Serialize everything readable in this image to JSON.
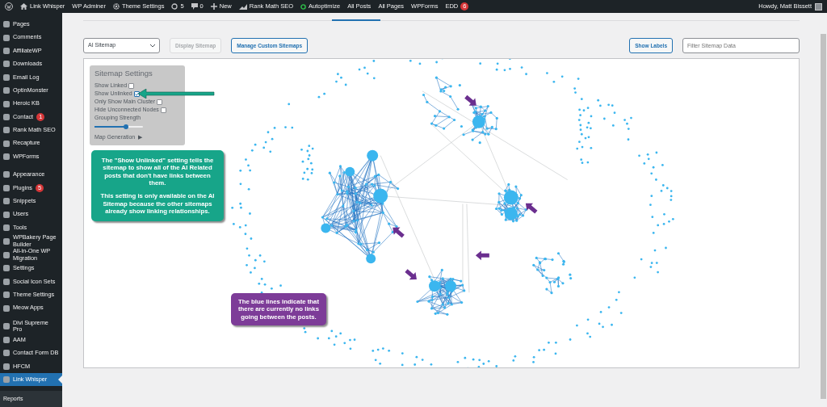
{
  "admin_bar": {
    "items": [
      {
        "kind": "logo"
      },
      {
        "kind": "home",
        "label": "Link Whisper"
      },
      {
        "kind": "text",
        "label": "WP Adminer"
      },
      {
        "kind": "gear",
        "label": "Theme Settings"
      },
      {
        "kind": "updates",
        "label": "5"
      },
      {
        "kind": "comments",
        "label": "0"
      },
      {
        "kind": "plus",
        "label": "New"
      },
      {
        "kind": "chart",
        "label": "Rank Math SEO"
      },
      {
        "kind": "status",
        "label": "Autoptimize"
      },
      {
        "kind": "text",
        "label": "All Posts"
      },
      {
        "kind": "text",
        "label": "All Pages"
      },
      {
        "kind": "text",
        "label": "WPForms"
      },
      {
        "kind": "text",
        "label": "EDD",
        "badge": "6"
      }
    ],
    "account": "Howdy, Matt Bissett"
  },
  "sidebar": {
    "groups": [
      [
        {
          "label": "Pages",
          "selected": false
        },
        {
          "label": "Comments",
          "selected": false
        },
        {
          "label": "AffiliateWP",
          "selected": false
        },
        {
          "label": "Downloads",
          "selected": false
        },
        {
          "label": "Email Log",
          "selected": false
        },
        {
          "label": "OptinMonster",
          "selected": false
        },
        {
          "label": "Heroic KB",
          "selected": false
        },
        {
          "label": "Contact",
          "selected": false,
          "badge": "1"
        },
        {
          "label": "Rank Math SEO",
          "selected": false
        },
        {
          "label": "Recapture",
          "selected": false
        },
        {
          "label": "WPForms",
          "selected": false
        }
      ],
      [
        {
          "label": "Appearance",
          "selected": false
        },
        {
          "label": "Plugins",
          "selected": false,
          "badge": "5"
        },
        {
          "label": "Snippets",
          "selected": false
        },
        {
          "label": "Users",
          "selected": false
        },
        {
          "label": "Tools",
          "selected": false
        },
        {
          "label": "WPBakery Page Builder",
          "selected": false
        },
        {
          "label": "All-in-One WP Migration",
          "selected": false
        },
        {
          "label": "Settings",
          "selected": false
        },
        {
          "label": "Social Icon Sets",
          "selected": false
        },
        {
          "label": "Theme Settings",
          "selected": false
        },
        {
          "label": "Meow Apps",
          "selected": false
        }
      ],
      [
        {
          "label": "Divi Supreme Pro",
          "selected": false
        },
        {
          "label": "AAM",
          "selected": false
        },
        {
          "label": "Contact Form DB",
          "selected": false
        },
        {
          "label": "HFCM",
          "selected": false
        },
        {
          "label": "Link Whisper",
          "selected": true
        }
      ]
    ],
    "submenu": [
      "Reports"
    ]
  },
  "toolbar": {
    "sitemap_select": "AI Sitemap",
    "display_button": {
      "label": "Display Sitemap",
      "disabled": true
    },
    "manage_button": {
      "label": "Manage Custom Sitemaps",
      "disabled": false
    },
    "labels_button": "Show Labels",
    "filter": {
      "placeholder": "Filter Sitemap Data"
    }
  },
  "settings": {
    "title": "Sitemap Settings",
    "options": [
      {
        "label": "Show Linked",
        "checked": false
      },
      {
        "label": "Show Unlinked",
        "checked": true
      },
      {
        "label": "Only Show Main Cluster",
        "checked": false
      },
      {
        "label": "Hide Unconnected Nodes",
        "checked": false
      }
    ],
    "slider": {
      "label": "Grouping Strength",
      "level": 0.65
    },
    "map_generation": {
      "label": "Map Generation",
      "toggle": "▶"
    }
  },
  "callouts": [
    {
      "color": "#17a589",
      "paragraphs": [
        "The \"Show Unlinked\" setting tells the sitemap to show all of the AI Related posts that don't have links between them.",
        "This setting is only available on the AI Sitemap because the other sitemaps already show linking relationships."
      ]
    },
    {
      "color": "#7d3c98",
      "paragraphs": [
        "The blue lines indicate that there are currently no links going between the posts."
      ]
    }
  ]
}
